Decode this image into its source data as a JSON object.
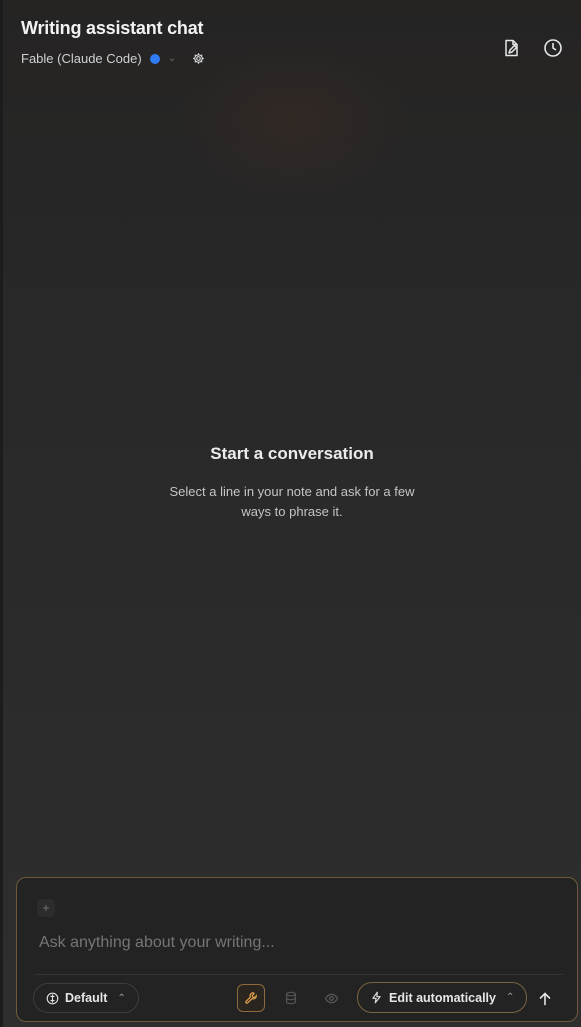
{
  "header": {
    "title": "Writing assistant chat",
    "model_label": "Fable (Claude Code)",
    "status_color": "#2f7cf6",
    "icons": [
      "new-note-icon",
      "history-icon"
    ]
  },
  "empty_state": {
    "title": "Start a conversation",
    "description": "Select a line in your note and ask for a few ways to phrase it."
  },
  "composer": {
    "placeholder": "Ask anything about your writing...",
    "mode_label": "Default",
    "edit_label": "Edit automatically",
    "accent_color": "#8c6a3c"
  }
}
